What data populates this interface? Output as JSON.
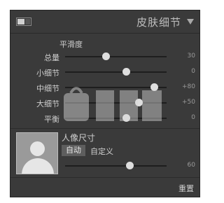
{
  "header": {
    "title": "皮肤细节"
  },
  "smoothness": {
    "section_label": "平滑度",
    "sliders": [
      {
        "label": "总量",
        "value": "30",
        "fraction": 0.4
      },
      {
        "label": "小细节",
        "value": "0",
        "fraction": 0.6
      },
      {
        "label": "中细节",
        "value": "+80",
        "fraction": 0.88
      },
      {
        "label": "大细节",
        "value": "+50",
        "fraction": 0.73
      },
      {
        "label": "平衡",
        "value": "0",
        "fraction": 0.6
      }
    ]
  },
  "portrait": {
    "title": "人像尺寸",
    "mode_auto": "自动",
    "mode_custom": "自定义",
    "value": "60",
    "fraction": 0.64
  },
  "footer": {
    "reset_label": "重置"
  },
  "colors": {
    "panel_bg": "#3a3a3a",
    "text": "#cfcfcf",
    "value_text": "#9a9a9a",
    "thumb": "#dedede"
  }
}
